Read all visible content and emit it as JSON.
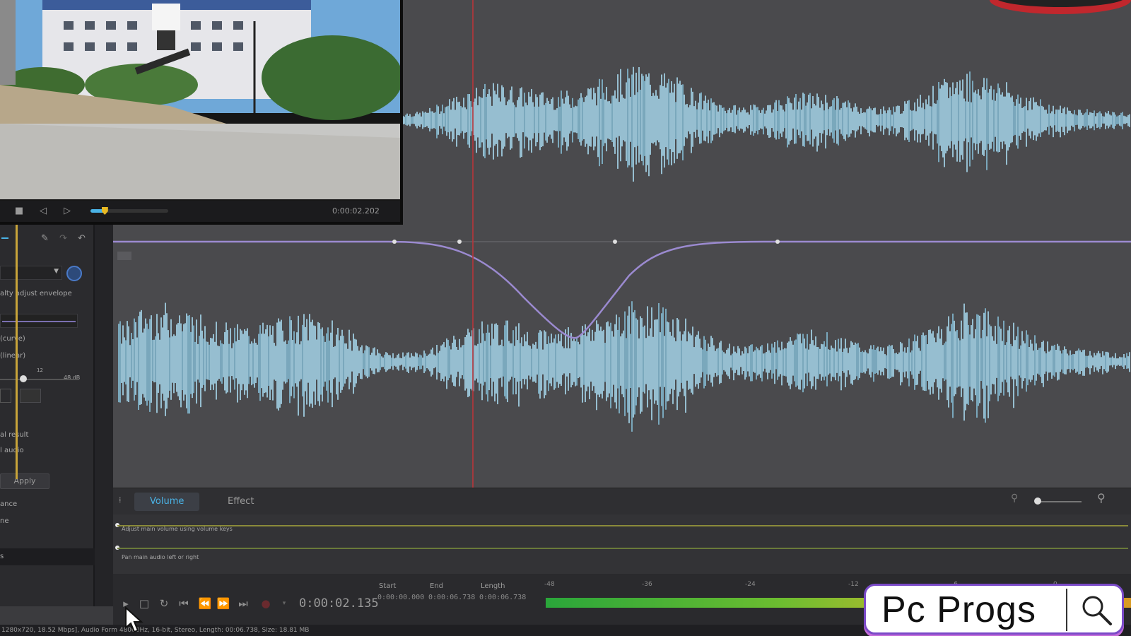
{
  "preview": {
    "time": "0:00:02.202",
    "progress_percent": 18
  },
  "side_panel": {
    "line1": "alty adjust envelope",
    "line2": "(curve)",
    "line3": "(linear)",
    "value_left": "12",
    "value_right": "48 dB",
    "line4": "al result",
    "line5": "l audio",
    "apply_label": "Apply",
    "line6": "ance",
    "line7": "ne",
    "line8": "s"
  },
  "tabs": {
    "volume": "Volume",
    "effect": "Effect"
  },
  "lanes": {
    "lane1": "Adjust main volume using volume keys",
    "lane2": "Pan main audio left or right"
  },
  "transport": {
    "time": "0:00:02.135",
    "start_label": "Start",
    "start_value": "0:00:00.000",
    "end_label": "End",
    "end_value": "0:00:06.738",
    "length_label": "Length",
    "length_value": "0:00:06.738",
    "meter_ticks": [
      "-48",
      "-36",
      "-24",
      "-12",
      "-6",
      "0"
    ]
  },
  "status_bar": {
    "text": "1280x720, 18.52 Mbps], Audio Form       48000Hz, 16-bit, Stereo, Length: 00:06.738, Size: 18.81 MB"
  },
  "watermark": {
    "text": "Pc Progs"
  },
  "colors": {
    "waveform": "#a9dcf1",
    "envelope": "#9b8ad0",
    "playhead": "#b8343a",
    "accent": "#4ab3e6"
  }
}
